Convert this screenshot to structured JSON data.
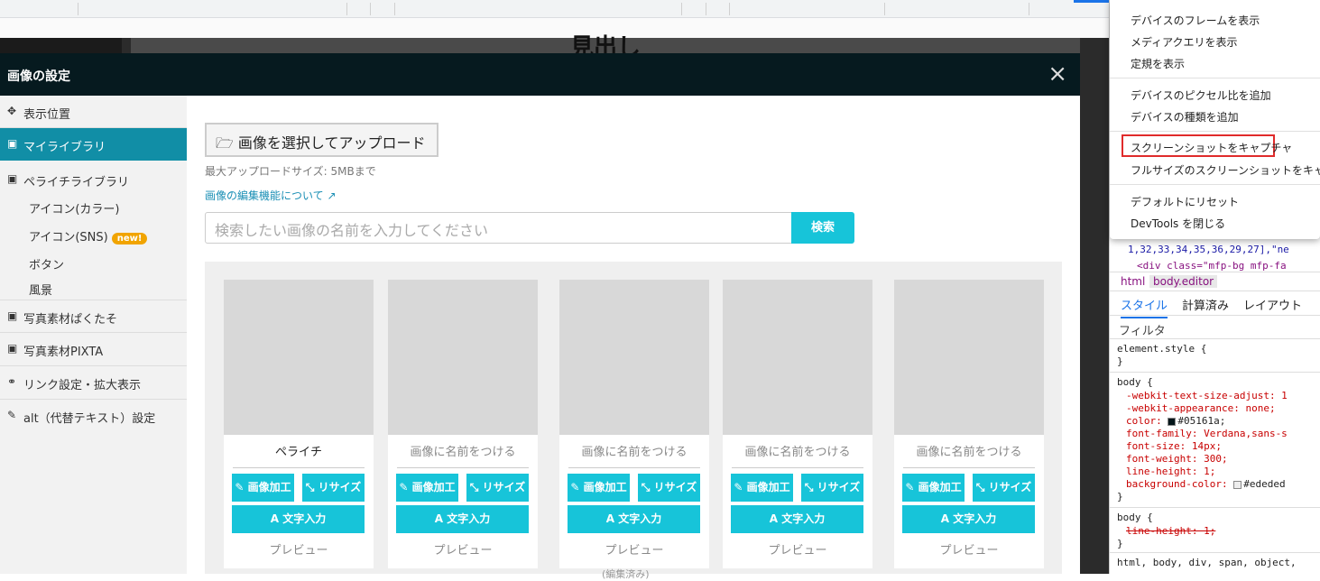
{
  "modal": {
    "title": "画像の設定",
    "close": "×"
  },
  "nav": {
    "items": [
      {
        "icon": "✥",
        "label": "表示位置"
      },
      {
        "icon": "▣",
        "label": "マイライブラリ"
      },
      {
        "icon": "▣",
        "label": "ペライチライブラリ"
      },
      {
        "icon": "▣",
        "label": "写真素材ぱくたそ"
      },
      {
        "icon": "▣",
        "label": "写真素材PIXTA"
      },
      {
        "icon": "⚭",
        "label": "リンク設定・拡大表示"
      },
      {
        "icon": "✎",
        "label": "alt（代替テキスト）設定"
      }
    ],
    "subitems": [
      "アイコン(カラー)",
      "アイコン(SNS)",
      "ボタン",
      "風景"
    ],
    "badge": "new!"
  },
  "content": {
    "upload_button": "🗁 画像を選択してアップロード",
    "max_size": "最大アップロードサイズ: 5MBまで",
    "edit_link": "画像の編集機能について ↗",
    "search_placeholder": "検索したい画像の名前を入力してください",
    "search_button": "検索",
    "cards": [
      {
        "name": "ペライチ"
      },
      {
        "name": "画像に名前をつける"
      },
      {
        "name": "画像に名前をつける"
      },
      {
        "name": "画像に名前をつける"
      },
      {
        "name": "画像に名前をつける"
      }
    ],
    "btn_edit": "画像加工",
    "btn_resize": "リサイズ",
    "btn_text": "A 文字入力",
    "preview": "プレビュー",
    "more": "(編集済み)"
  },
  "menu": {
    "items": [
      "デバイスのフレームを表示",
      "メディアクエリを表示",
      "定規を表示",
      "デバイスのピクセル比を追加",
      "デバイスの種類を追加",
      "スクリーンショットをキャプチャ",
      "フルサイズのスクリーンショットをキャプチャ",
      "デフォルトにリセット",
      "DevTools を閉じる"
    ]
  },
  "devtools": {
    "code_line1": "1,32,33,34,35,36,29,27],\"ne",
    "code_line2": "<div class=\"mfp-bg mfp-fa",
    "crumbs": [
      "html",
      "body.editor"
    ],
    "tabs": [
      "スタイル",
      "計算済み",
      "レイアウト"
    ],
    "filter": "フィルタ",
    "rules": {
      "r1": "element.style {",
      "r1end": "}",
      "r2": "body {",
      "p1": "-webkit-text-size-adjust: 1",
      "p2": "-webkit-appearance: none;",
      "p3": "color: #05161a;",
      "p4": "font-family: Verdana,sans-s",
      "p5": "font-size: 14px;",
      "p6": "font-weight: 300;",
      "p7": "line-height: 1;",
      "p8": "background-color: #ededed",
      "r2end": "}",
      "r3": "body {",
      "p9": "line-height: 1;",
      "r3end": "}",
      "r4": "html, body, div, span, object,"
    }
  },
  "page_heading": "見出し"
}
